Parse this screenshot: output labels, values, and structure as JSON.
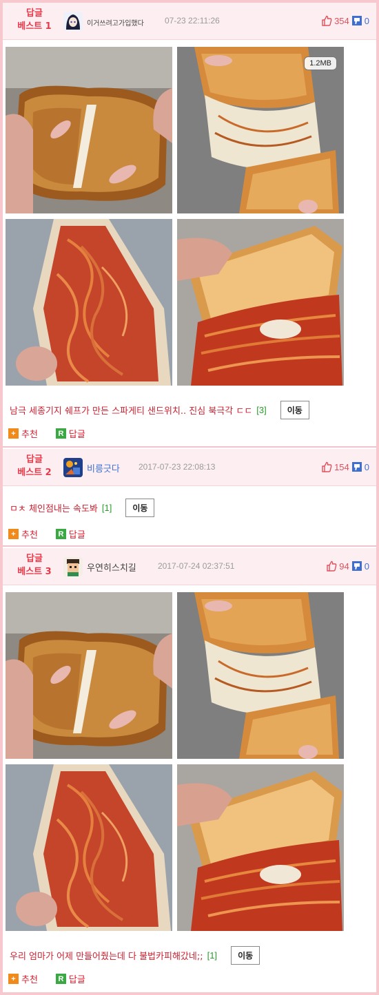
{
  "posts": [
    {
      "badge_top": "답글",
      "badge_bottom": "베스트 1",
      "author": "이거쓰려고가입했다",
      "timestamp": "07-23 22:11:26",
      "upvotes": "354",
      "downvotes": "0",
      "image_size": "1.2MB",
      "title": "남극 세종기지 쉐프가 만든 스파게티 샌드위치.. 진심 북극각 ㄷㄷ",
      "reply_count": "[3]",
      "move_label": "이동",
      "recommend_label": "추천",
      "reply_label": "답글"
    },
    {
      "badge_top": "답글",
      "badge_bottom": "베스트 2",
      "author": "비릉긋다",
      "timestamp": "2017-07-23 22:08:13",
      "upvotes": "154",
      "downvotes": "0",
      "title": "ㅁㅊ 체인점내는 속도봐",
      "reply_count": "[1]",
      "move_label": "이동",
      "recommend_label": "추천",
      "reply_label": "답글"
    },
    {
      "badge_top": "답글",
      "badge_bottom": "베스트 3",
      "author": "우연히스치길",
      "timestamp": "2017-07-24 02:37:51",
      "upvotes": "94",
      "downvotes": "0",
      "title": "우리 엄마가 어제 만들어줬는데 다 불법카피해갔네;;",
      "reply_count": "[1]",
      "move_label": "이동",
      "recommend_label": "추천",
      "reply_label": "답글"
    }
  ],
  "colors": {
    "accent": "#e53a4b",
    "upvote": "#e0505c",
    "downvote": "#3c6fd1",
    "reply_count": "#2a9b2a",
    "frame": "#f7c9cf"
  }
}
